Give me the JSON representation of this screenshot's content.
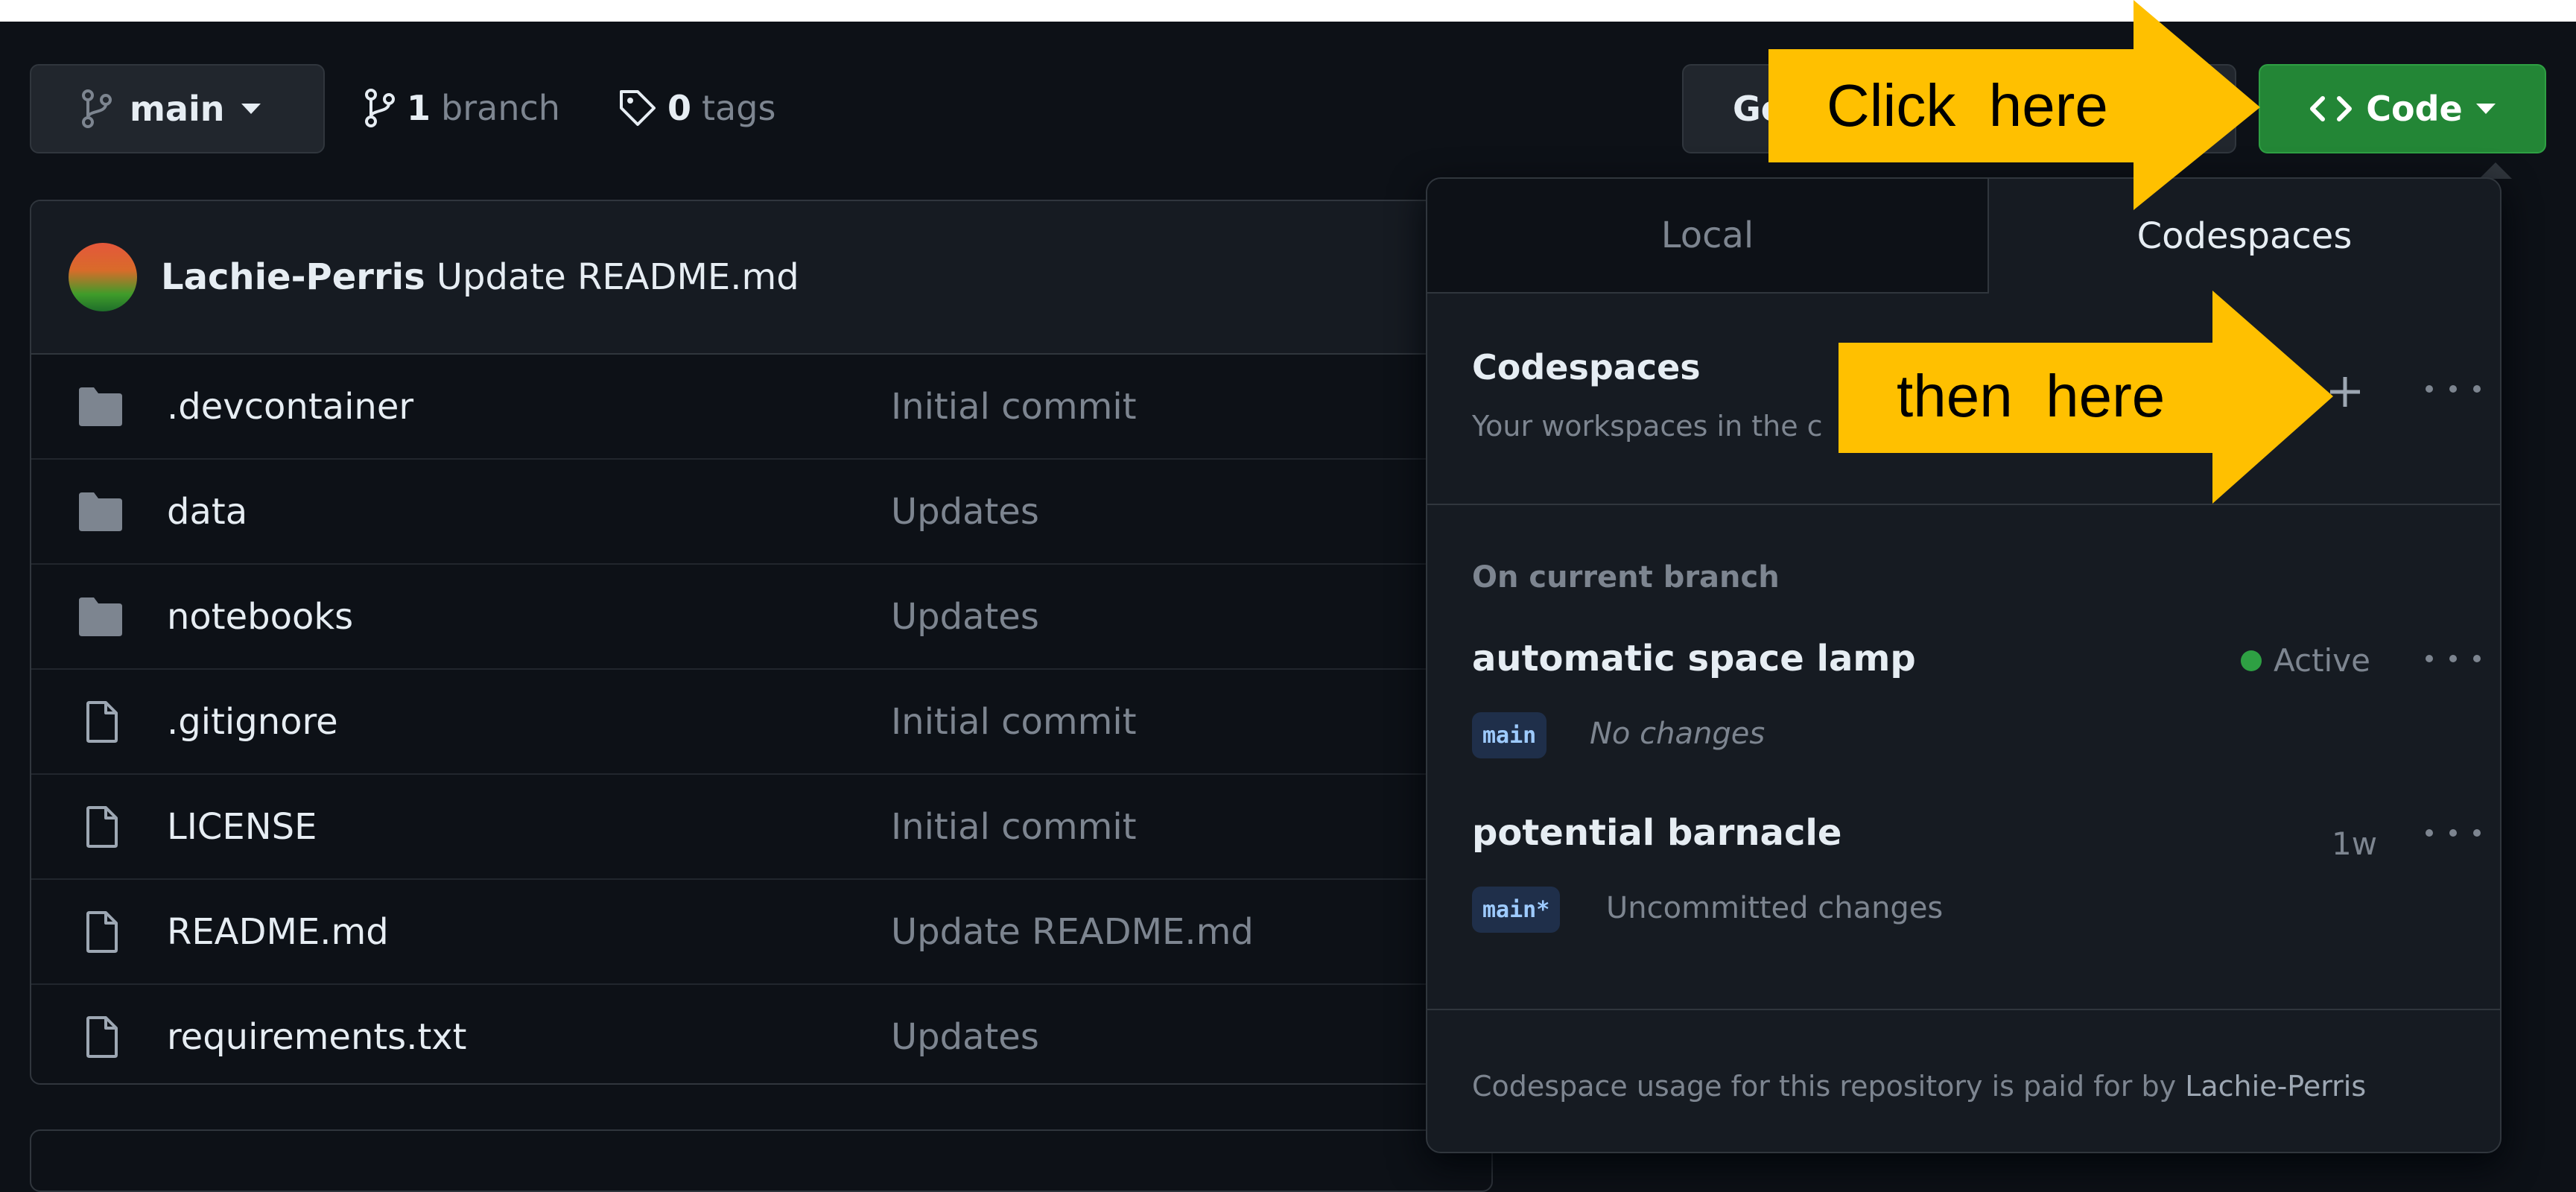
{
  "repo_toolbar": {
    "branch_button": "main",
    "branches_count": "1",
    "branches_label": "branch",
    "tags_count": "0",
    "tags_label": "tags",
    "goto_file_label": "Go",
    "code_button": "Code"
  },
  "latest_commit": {
    "author": "Lachie-Perris",
    "message": "Update README.md"
  },
  "files": [
    {
      "name": ".devcontainer",
      "type": "folder",
      "message": "Initial commit"
    },
    {
      "name": "data",
      "type": "folder",
      "message": "Updates"
    },
    {
      "name": "notebooks",
      "type": "folder",
      "message": "Updates"
    },
    {
      "name": ".gitignore",
      "type": "file",
      "message": "Initial commit"
    },
    {
      "name": "LICENSE",
      "type": "file",
      "message": "Initial commit"
    },
    {
      "name": "README.md",
      "type": "file",
      "message": "Update README.md"
    },
    {
      "name": "requirements.txt",
      "type": "file",
      "message": "Updates"
    }
  ],
  "code_popover": {
    "tabs": [
      "Local",
      "Codespaces"
    ],
    "active_tab": "Codespaces",
    "section_title": "Codespaces",
    "section_subtitle": "Your workspaces in the c",
    "on_current_branch_label": "On current branch",
    "codespaces": [
      {
        "name": "automatic space lamp",
        "branch": "main",
        "note": "No changes",
        "status": "Active"
      },
      {
        "name": "potential barnacle",
        "branch": "main*",
        "note": "Uncommitted changes",
        "time": "1w"
      }
    ],
    "footer_text": "Codespace usage for this repository is paid for by",
    "footer_owner": "Lachie-Perris"
  },
  "annotations": {
    "callout_1": "Click  here",
    "callout_2": "then  here",
    "callout_color": "#ffc000"
  },
  "colors": {
    "background": "#0d1117",
    "code_button": "#238636",
    "active_dot": "#2ea043"
  }
}
